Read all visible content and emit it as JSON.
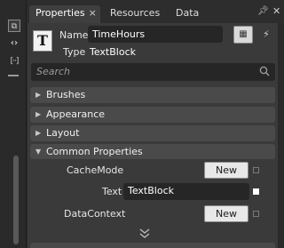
{
  "tabs": [
    {
      "label": "Properties",
      "active": true
    },
    {
      "label": "Resources",
      "active": false
    },
    {
      "label": "Data",
      "active": false
    }
  ],
  "tab_close_glyph": "×",
  "element": {
    "name_label": "Name",
    "name_value": "TimeHours",
    "type_label": "Type",
    "type_value": "TextBlock",
    "icon": "textblock-type-icon"
  },
  "search": {
    "placeholder": "Search"
  },
  "categories": [
    {
      "label": "Brushes",
      "expanded": false
    },
    {
      "label": "Appearance",
      "expanded": false
    },
    {
      "label": "Layout",
      "expanded": false
    },
    {
      "label": "Common Properties",
      "expanded": true
    }
  ],
  "common_properties": {
    "cache_mode_label": "CacheMode",
    "cache_mode_button": "New",
    "text_label": "Text",
    "text_value": "TextBlock",
    "data_context_label": "DataContext",
    "data_context_button": "New"
  },
  "colors": {
    "panel": "#3a3a3a",
    "input": "#262626",
    "category": "#4a4a4a"
  }
}
